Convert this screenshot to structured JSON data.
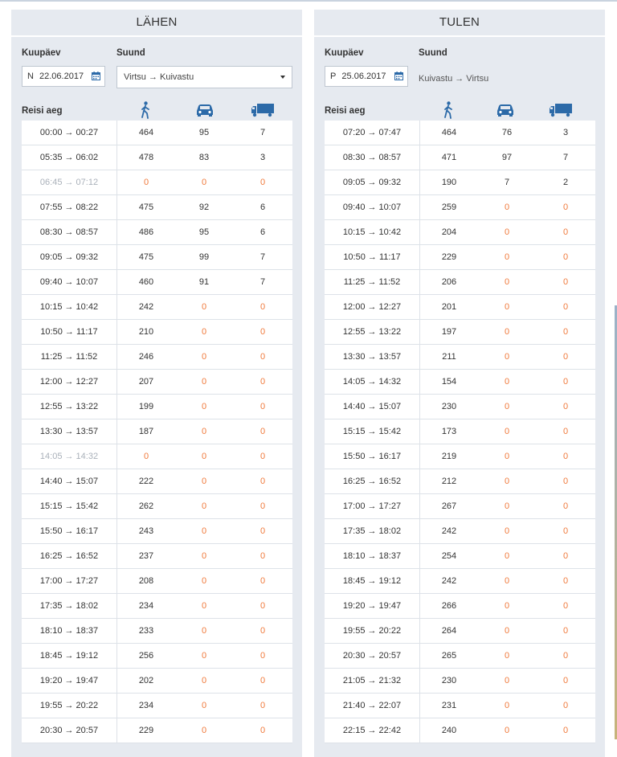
{
  "left": {
    "title": "LÄHEN",
    "date_label": "Kuupäev",
    "direction_label": "Suund",
    "date_day": "N",
    "date_value": "22.06.2017",
    "direction_value": "Virtsu → Kuivastu",
    "trip_time_label": "Reisi aeg",
    "rows": [
      {
        "time": "00:00 → 00:27",
        "p": "464",
        "c": "95",
        "t": "7",
        "off": false
      },
      {
        "time": "05:35 → 06:02",
        "p": "478",
        "c": "83",
        "t": "3",
        "off": false
      },
      {
        "time": "06:45 → 07:12",
        "p": "0",
        "c": "0",
        "t": "0",
        "off": true
      },
      {
        "time": "07:55 → 08:22",
        "p": "475",
        "c": "92",
        "t": "6",
        "off": false
      },
      {
        "time": "08:30 → 08:57",
        "p": "486",
        "c": "95",
        "t": "6",
        "off": false
      },
      {
        "time": "09:05 → 09:32",
        "p": "475",
        "c": "99",
        "t": "7",
        "off": false
      },
      {
        "time": "09:40 → 10:07",
        "p": "460",
        "c": "91",
        "t": "7",
        "off": false
      },
      {
        "time": "10:15 → 10:42",
        "p": "242",
        "c": "0",
        "t": "0",
        "off": false
      },
      {
        "time": "10:50 → 11:17",
        "p": "210",
        "c": "0",
        "t": "0",
        "off": false
      },
      {
        "time": "11:25 → 11:52",
        "p": "246",
        "c": "0",
        "t": "0",
        "off": false
      },
      {
        "time": "12:00 → 12:27",
        "p": "207",
        "c": "0",
        "t": "0",
        "off": false
      },
      {
        "time": "12:55 → 13:22",
        "p": "199",
        "c": "0",
        "t": "0",
        "off": false
      },
      {
        "time": "13:30 → 13:57",
        "p": "187",
        "c": "0",
        "t": "0",
        "off": false
      },
      {
        "time": "14:05 → 14:32",
        "p": "0",
        "c": "0",
        "t": "0",
        "off": true
      },
      {
        "time": "14:40 → 15:07",
        "p": "222",
        "c": "0",
        "t": "0",
        "off": false
      },
      {
        "time": "15:15 → 15:42",
        "p": "262",
        "c": "0",
        "t": "0",
        "off": false
      },
      {
        "time": "15:50 → 16:17",
        "p": "243",
        "c": "0",
        "t": "0",
        "off": false
      },
      {
        "time": "16:25 → 16:52",
        "p": "237",
        "c": "0",
        "t": "0",
        "off": false
      },
      {
        "time": "17:00 → 17:27",
        "p": "208",
        "c": "0",
        "t": "0",
        "off": false
      },
      {
        "time": "17:35 → 18:02",
        "p": "234",
        "c": "0",
        "t": "0",
        "off": false
      },
      {
        "time": "18:10 → 18:37",
        "p": "233",
        "c": "0",
        "t": "0",
        "off": false
      },
      {
        "time": "18:45 → 19:12",
        "p": "256",
        "c": "0",
        "t": "0",
        "off": false
      },
      {
        "time": "19:20 → 19:47",
        "p": "202",
        "c": "0",
        "t": "0",
        "off": false
      },
      {
        "time": "19:55 → 20:22",
        "p": "234",
        "c": "0",
        "t": "0",
        "off": false
      },
      {
        "time": "20:30 → 20:57",
        "p": "229",
        "c": "0",
        "t": "0",
        "off": false
      }
    ]
  },
  "right": {
    "title": "TULEN",
    "date_label": "Kuupäev",
    "direction_label": "Suund",
    "date_day": "P",
    "date_value": "25.06.2017",
    "direction_value": "Kuivastu → Virtsu",
    "trip_time_label": "Reisi aeg",
    "rows": [
      {
        "time": "07:20 → 07:47",
        "p": "464",
        "c": "76",
        "t": "3",
        "off": false
      },
      {
        "time": "08:30 → 08:57",
        "p": "471",
        "c": "97",
        "t": "7",
        "off": false
      },
      {
        "time": "09:05 → 09:32",
        "p": "190",
        "c": "7",
        "t": "2",
        "off": false
      },
      {
        "time": "09:40 → 10:07",
        "p": "259",
        "c": "0",
        "t": "0",
        "off": false
      },
      {
        "time": "10:15 → 10:42",
        "p": "204",
        "c": "0",
        "t": "0",
        "off": false
      },
      {
        "time": "10:50 → 11:17",
        "p": "229",
        "c": "0",
        "t": "0",
        "off": false
      },
      {
        "time": "11:25 → 11:52",
        "p": "206",
        "c": "0",
        "t": "0",
        "off": false
      },
      {
        "time": "12:00 → 12:27",
        "p": "201",
        "c": "0",
        "t": "0",
        "off": false
      },
      {
        "time": "12:55 → 13:22",
        "p": "197",
        "c": "0",
        "t": "0",
        "off": false
      },
      {
        "time": "13:30 → 13:57",
        "p": "211",
        "c": "0",
        "t": "0",
        "off": false
      },
      {
        "time": "14:05 → 14:32",
        "p": "154",
        "c": "0",
        "t": "0",
        "off": false
      },
      {
        "time": "14:40 → 15:07",
        "p": "230",
        "c": "0",
        "t": "0",
        "off": false
      },
      {
        "time": "15:15 → 15:42",
        "p": "173",
        "c": "0",
        "t": "0",
        "off": false
      },
      {
        "time": "15:50 → 16:17",
        "p": "219",
        "c": "0",
        "t": "0",
        "off": false
      },
      {
        "time": "16:25 → 16:52",
        "p": "212",
        "c": "0",
        "t": "0",
        "off": false
      },
      {
        "time": "17:00 → 17:27",
        "p": "267",
        "c": "0",
        "t": "0",
        "off": false
      },
      {
        "time": "17:35 → 18:02",
        "p": "242",
        "c": "0",
        "t": "0",
        "off": false
      },
      {
        "time": "18:10 → 18:37",
        "p": "254",
        "c": "0",
        "t": "0",
        "off": false
      },
      {
        "time": "18:45 → 19:12",
        "p": "242",
        "c": "0",
        "t": "0",
        "off": false
      },
      {
        "time": "19:20 → 19:47",
        "p": "266",
        "c": "0",
        "t": "0",
        "off": false
      },
      {
        "time": "19:55 → 20:22",
        "p": "264",
        "c": "0",
        "t": "0",
        "off": false
      },
      {
        "time": "20:30 → 20:57",
        "p": "265",
        "c": "0",
        "t": "0",
        "off": false
      },
      {
        "time": "21:05 → 21:32",
        "p": "230",
        "c": "0",
        "t": "0",
        "off": false
      },
      {
        "time": "21:40 → 22:07",
        "p": "231",
        "c": "0",
        "t": "0",
        "off": false
      },
      {
        "time": "22:15 → 22:42",
        "p": "240",
        "c": "0",
        "t": "0",
        "off": false
      }
    ]
  },
  "icons": {
    "passenger": "walking-person-icon",
    "car": "car-icon",
    "truck": "truck-icon",
    "calendar": "calendar-icon"
  },
  "colors": {
    "accent": "#2c6aa8",
    "zero": "#f07a3c",
    "panel_bg": "#e6eaf0"
  }
}
